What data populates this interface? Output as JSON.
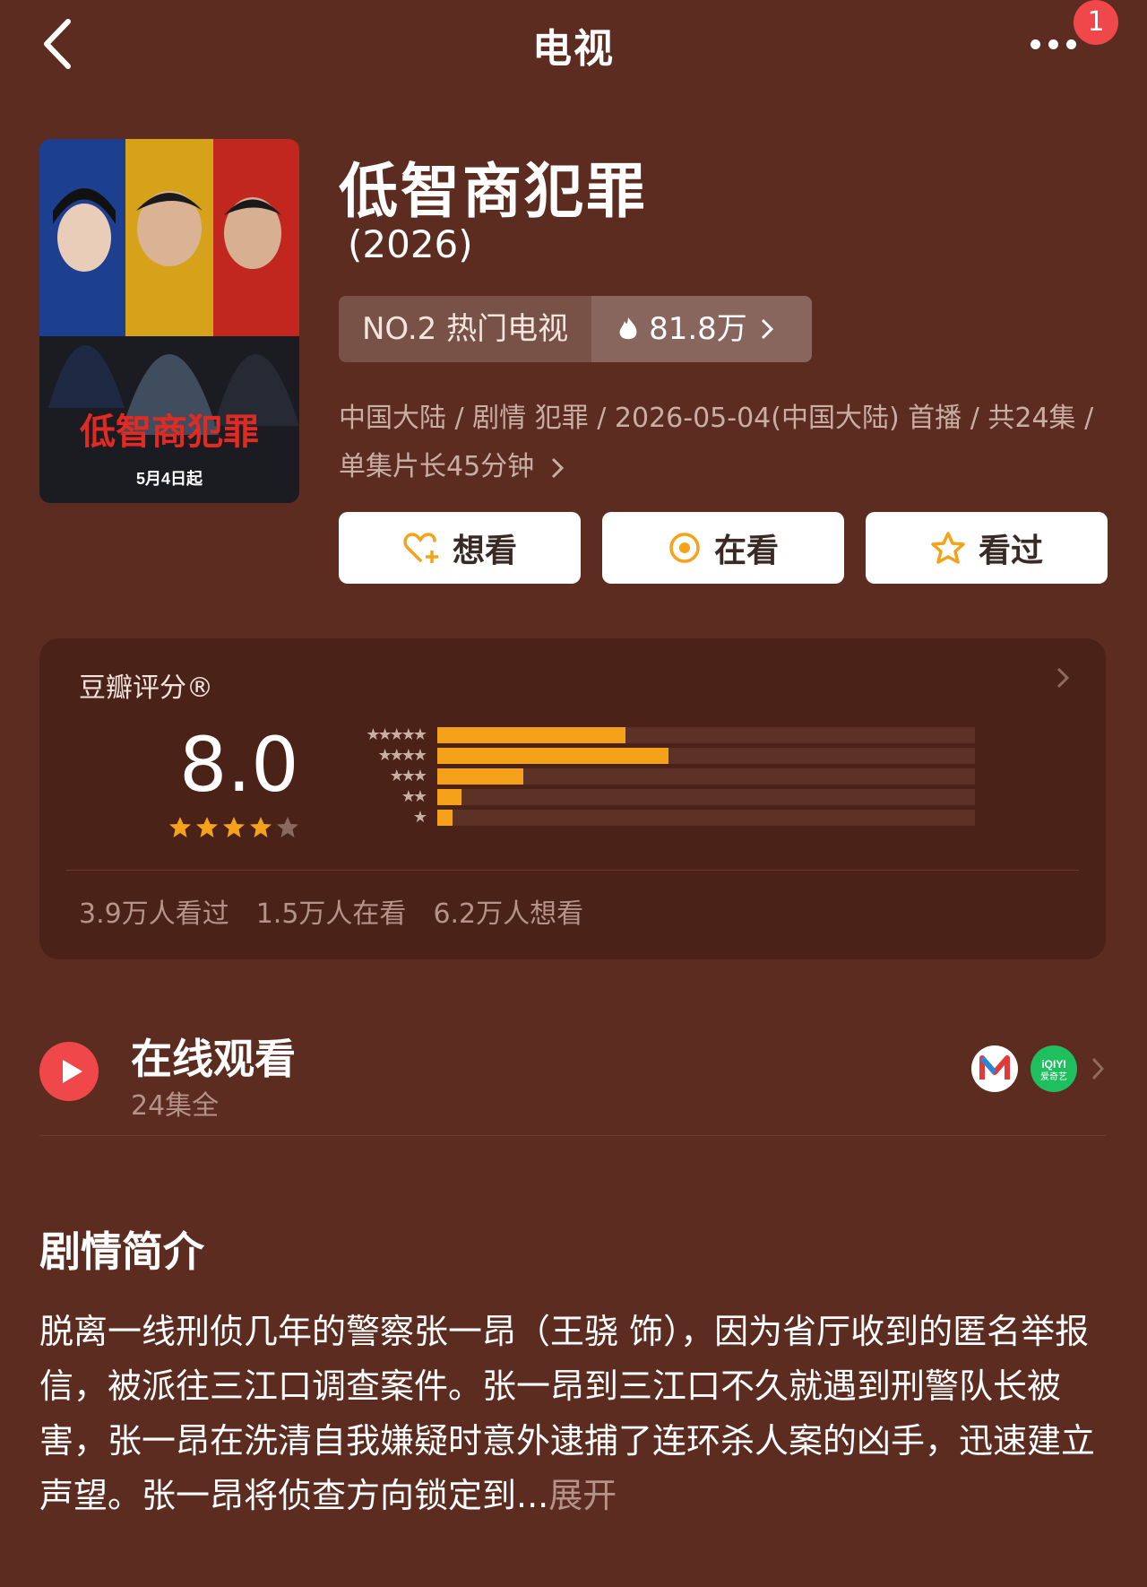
{
  "header": {
    "title": "电视",
    "badge_count": "1"
  },
  "poster": {
    "title_art": "低智商犯罪",
    "date_label": "5月4日起"
  },
  "show": {
    "title": "低智商犯罪",
    "year": "(2026)",
    "rank_label": "NO.2 热门电视",
    "heat_value": "81.8万",
    "meta": "中国大陆 / 剧情 犯罪 / 2026-05-04(中国大陆) 首播 / 共24集 / 单集片长45分钟"
  },
  "actions": {
    "want": "想看",
    "watching": "在看",
    "watched": "看过"
  },
  "rating": {
    "label": "豆瓣评分®",
    "score": "8.0",
    "stars": 4,
    "distribution": [
      {
        "stars": "★★★★★",
        "value": 0.35
      },
      {
        "stars": "★★★★",
        "value": 0.43
      },
      {
        "stars": "★★★",
        "value": 0.16
      },
      {
        "stars": "★★",
        "value": 0.045
      },
      {
        "stars": "★",
        "value": 0.028
      }
    ],
    "watched_count": "3.9万人看过",
    "watching_count": "1.5万人在看",
    "want_count": "6.2万人想看"
  },
  "online": {
    "title": "在线观看",
    "subtitle": "24集全",
    "platform_2": "iQIYI 爱奇艺"
  },
  "synopsis": {
    "title": "剧情简介",
    "text": "脱离一线刑侦几年的警察张一昂（王骁 饰），因为省厅收到的匿名举报信，被派往三江口调查案件。张一昂到三江口不久就遇到刑警队长被害，张一昂在洗清自我嫌疑时意外逮捕了连环杀人案的凶手，迅速建立声望。张一昂将侦查方向锁定到...",
    "expand": "展开"
  },
  "colors": {
    "background": "#5b2c1f",
    "accent_orange": "#f5a21a",
    "badge_red": "#f0484a"
  }
}
